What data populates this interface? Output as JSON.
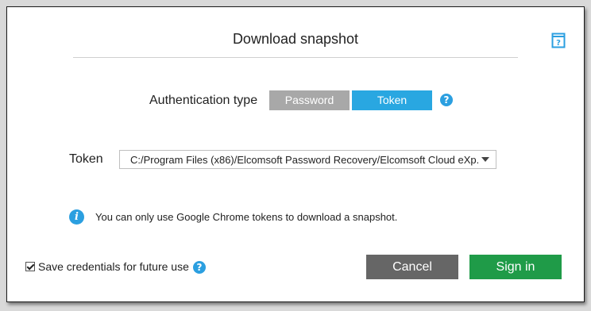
{
  "dialog": {
    "title": "Download snapshot",
    "help_icon": "help-book-icon"
  },
  "auth": {
    "label": "Authentication type",
    "options": [
      "Password",
      "Token"
    ],
    "selected": "Token",
    "help_icon": "?"
  },
  "token": {
    "label": "Token",
    "value": "C:/Program Files (x86)/Elcomsoft Password Recovery/Elcomsoft Cloud eXp..."
  },
  "info": {
    "icon_glyph": "i",
    "text": "You can only use Google Chrome tokens to download a snapshot."
  },
  "footer": {
    "save_credentials_label": "Save credentials for future use",
    "save_credentials_checked": true,
    "help_icon": "?",
    "cancel_label": "Cancel",
    "signin_label": "Sign in"
  },
  "colors": {
    "accent": "#29a7e1",
    "inactive_segment": "#a8a8a8",
    "cancel": "#666666",
    "signin": "#1f9b48"
  }
}
